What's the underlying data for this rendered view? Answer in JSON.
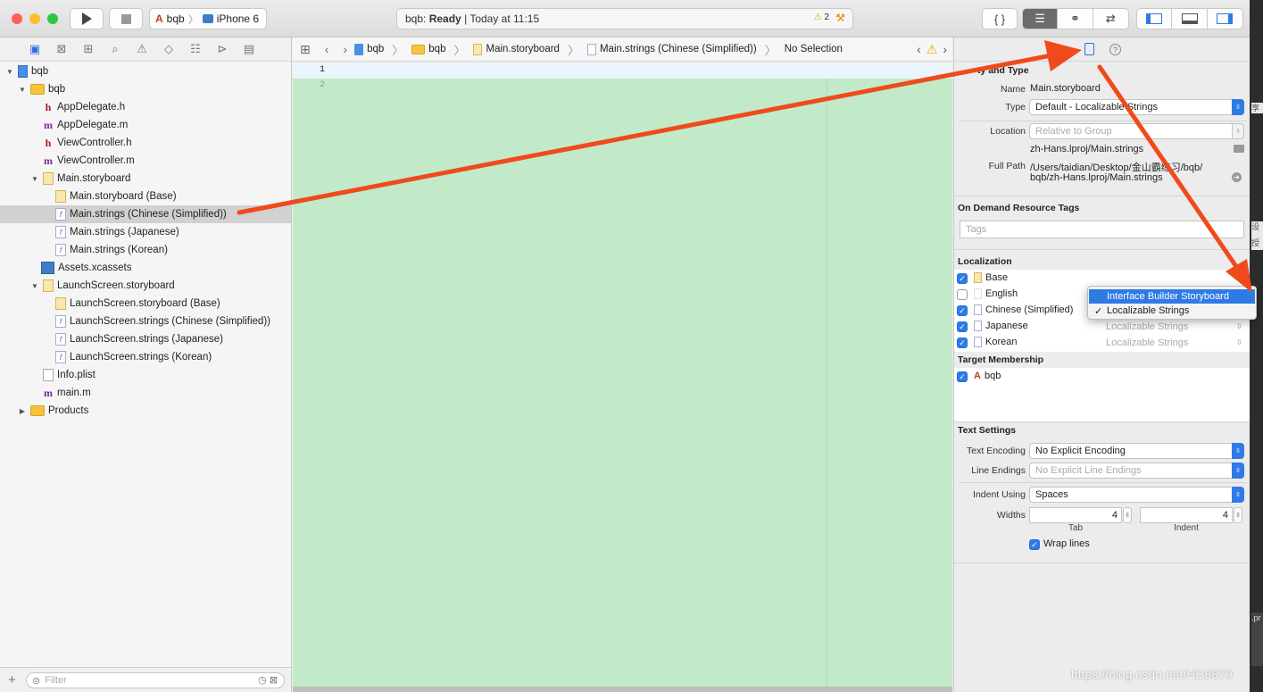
{
  "toolbar": {
    "scheme_name": "bqb",
    "device": "iPhone 6",
    "status_project": "bqb:",
    "status_state": "Ready",
    "status_time": "| Today at 11:15",
    "warning_count": "2"
  },
  "navigator": {
    "filter_placeholder": "Filter",
    "items": [
      {
        "label": "bqb"
      },
      {
        "label": "bqb"
      },
      {
        "label": "AppDelegate.h"
      },
      {
        "label": "AppDelegate.m"
      },
      {
        "label": "ViewController.h"
      },
      {
        "label": "ViewController.m"
      },
      {
        "label": "Main.storyboard"
      },
      {
        "label": "Main.storyboard (Base)"
      },
      {
        "label": "Main.strings (Chinese (Simplified))"
      },
      {
        "label": "Main.strings (Japanese)"
      },
      {
        "label": "Main.strings (Korean)"
      },
      {
        "label": "Assets.xcassets"
      },
      {
        "label": "LaunchScreen.storyboard"
      },
      {
        "label": "LaunchScreen.storyboard (Base)"
      },
      {
        "label": "LaunchScreen.strings (Chinese (Simplified))"
      },
      {
        "label": "LaunchScreen.strings (Japanese)"
      },
      {
        "label": "LaunchScreen.strings (Korean)"
      },
      {
        "label": "Info.plist"
      },
      {
        "label": "main.m"
      },
      {
        "label": "Products"
      }
    ]
  },
  "jumpbar": {
    "crumbs": [
      "bqb",
      "bqb",
      "Main.storyboard",
      "Main.strings (Chinese (Simplified))",
      "No Selection"
    ]
  },
  "editor": {
    "line_numbers": [
      "1",
      "2"
    ]
  },
  "inspector": {
    "identity": {
      "section_title": "ty and Type",
      "name_label": "Name",
      "name_value": "Main.storyboard",
      "type_label": "Type",
      "type_value": "Default - Localizable Strings",
      "location_label": "Location",
      "location_value": "Relative to Group",
      "location_path": "zh-Hans.lproj/Main.strings",
      "fullpath_label": "Full Path",
      "fullpath_line1": "/Users/taidian/Desktop/金山霸练习/bqb/",
      "fullpath_line2": "bqb/zh-Hans.lproj/Main.strings"
    },
    "odr": {
      "section_title": "On Demand Resource Tags",
      "tags_placeholder": "Tags"
    },
    "localization": {
      "section_title": "Localization",
      "rows": [
        {
          "name": "Base",
          "checked": true,
          "type": ""
        },
        {
          "name": "English",
          "checked": false,
          "type": ""
        },
        {
          "name": "Chinese (Simplified)",
          "checked": true,
          "type": ""
        },
        {
          "name": "Japanese",
          "checked": true,
          "type": "Localizable Strings"
        },
        {
          "name": "Korean",
          "checked": true,
          "type": "Localizable Strings"
        }
      ],
      "menu": [
        "Interface Builder Storyboard",
        "Localizable Strings"
      ]
    },
    "membership": {
      "section_title": "Target Membership",
      "target": "bqb"
    },
    "text_settings": {
      "section_title": "Text Settings",
      "encoding_label": "Text Encoding",
      "encoding_value": "No Explicit Encoding",
      "endings_label": "Line Endings",
      "endings_value": "No Explicit Line Endings",
      "indent_label": "Indent Using",
      "indent_value": "Spaces",
      "widths_label": "Widths",
      "tab_value": "4",
      "indent_width_value": "4",
      "tab_caption": "Tab",
      "indent_caption": "Indent",
      "wrap_label": "Wrap lines"
    }
  },
  "watermark": "https://blog.csdn.net/HD6870",
  "side_strip": [
    "享",
    "设",
    "授",
    ".pr"
  ],
  "colors": {
    "accent": "#2f7be6",
    "editor_bg": "#c2eac8",
    "arrow": "#f04a1c",
    "close": "#fe5f57",
    "minimize": "#febc2e",
    "zoom": "#28c840"
  }
}
